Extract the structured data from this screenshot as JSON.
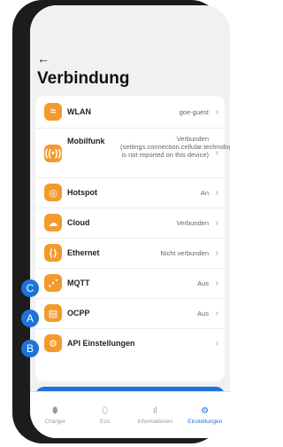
{
  "header": {
    "back_icon": "←",
    "title": "Verbindung"
  },
  "rows": [
    {
      "icon": "wifi-icon",
      "glyph": "≈",
      "label": "WLAN",
      "value": "goe-guest"
    },
    {
      "icon": "mobile-signal-icon",
      "glyph": "((•))",
      "label": "Mobilfunk",
      "value": "Verbunden (settings.connection.cellular.technology.2G/4G is not reported on this device)"
    },
    {
      "icon": "hotspot-icon",
      "glyph": "◎",
      "label": "Hotspot",
      "value": "An"
    },
    {
      "icon": "cloud-icon",
      "glyph": "☁",
      "label": "Cloud",
      "value": "Verbunden"
    },
    {
      "icon": "ethernet-icon",
      "glyph": "⟨⟩",
      "label": "Ethernet",
      "value": "Nicht verbunden"
    },
    {
      "icon": "mqtt-icon",
      "glyph": "⋰",
      "label": "MQTT",
      "value": "Aus"
    },
    {
      "icon": "ocpp-icon",
      "glyph": "▤",
      "label": "OCPP",
      "value": "Aus"
    },
    {
      "icon": "api-icon",
      "glyph": "⚙",
      "label": "API Einstellungen",
      "value": ""
    }
  ],
  "badges": {
    "c": "C",
    "a": "A",
    "b": "B"
  },
  "tabs": [
    {
      "label": "Charger",
      "glyph": "⬮"
    },
    {
      "label": "Eco",
      "glyph": "⬯"
    },
    {
      "label": "Informationen",
      "glyph": "ıl"
    },
    {
      "label": "Einstellungen",
      "glyph": "⚙"
    }
  ],
  "colors": {
    "accent": "#1e73d8",
    "icon_bg": "#f39a2e"
  }
}
